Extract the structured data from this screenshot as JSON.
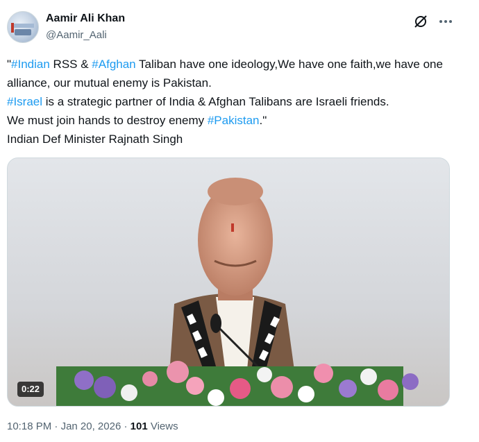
{
  "author": {
    "name": "Aamir Ali Khan",
    "handle": "@Aamir_Aali"
  },
  "icons": {
    "grok": "grok-icon",
    "more": "more-dots-icon"
  },
  "tweet": {
    "line1_pre": "\"",
    "tag_indian": "#Indian",
    "line1_mid": " RSS & ",
    "tag_afghan": "#Afghan",
    "line1_post": " Taliban have one ideology,We have one faith,we have one alliance, our mutual enemy is Pakistan.",
    "tag_israel": "#Israel",
    "line2_post": " is a strategic partner of India & Afghan Talibans are Israeli friends.",
    "line3_pre": "We must join hands to destroy  enemy ",
    "tag_pakistan": "#Pakistan",
    "line3_post": ".\"",
    "line4": "Indian Def Minister Rajnath Singh"
  },
  "video": {
    "duration": "0:22"
  },
  "meta": {
    "time": "10:18 PM",
    "separator1": " · ",
    "date": "Jan 20, 2026",
    "separator2": " · ",
    "views_count": "101",
    "views_label": " Views"
  },
  "colors": {
    "link": "#1d9bf0",
    "text": "#0f1419",
    "secondary": "#536471"
  }
}
